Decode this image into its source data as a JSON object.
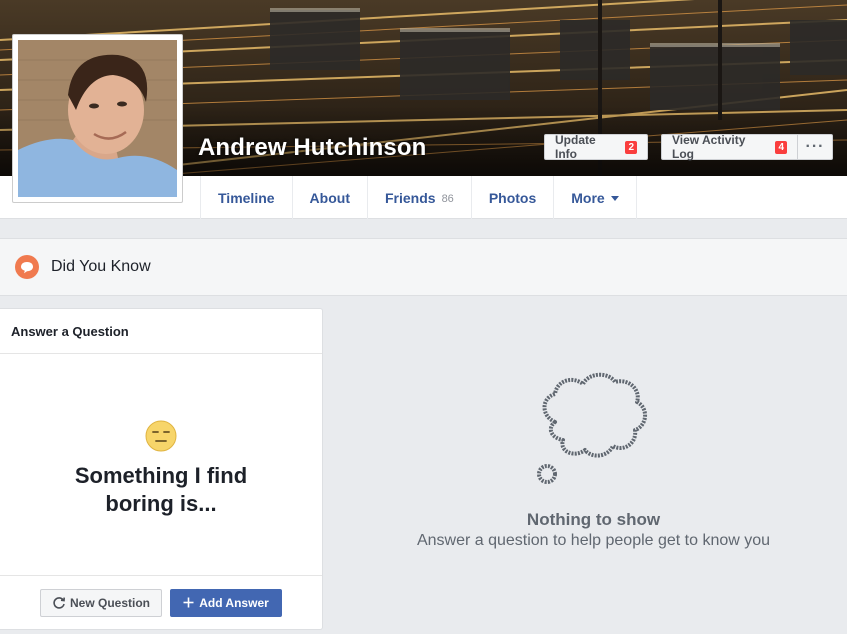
{
  "profile": {
    "name": "Andrew Hutchinson"
  },
  "cover_actions": {
    "update_info_label": "Update Info",
    "update_info_count": "2",
    "activity_log_label": "View Activity Log",
    "activity_log_count": "4",
    "more_label": "···"
  },
  "nav": {
    "tabs": [
      {
        "label": "Timeline"
      },
      {
        "label": "About"
      },
      {
        "label": "Friends",
        "count": "86"
      },
      {
        "label": "Photos"
      },
      {
        "label": "More"
      }
    ]
  },
  "section": {
    "title": "Did You Know"
  },
  "question_card": {
    "header": "Answer a Question",
    "question": "Something I find boring is...",
    "new_question_label": "New Question",
    "add_answer_label": "Add Answer"
  },
  "empty_state": {
    "title": "Nothing to show",
    "subtitle": "Answer a question to help people get to know you"
  },
  "colors": {
    "link": "#365899",
    "primary_button": "#4267b2",
    "badge": "#fa3e3e",
    "section_icon": "#f07a4f"
  },
  "icons": {
    "section": "speech-bubble-icon",
    "emoji": "expressionless-face-icon",
    "new_question": "refresh-icon",
    "add_answer": "plus-icon",
    "empty_state": "thought-bubble-icon"
  }
}
